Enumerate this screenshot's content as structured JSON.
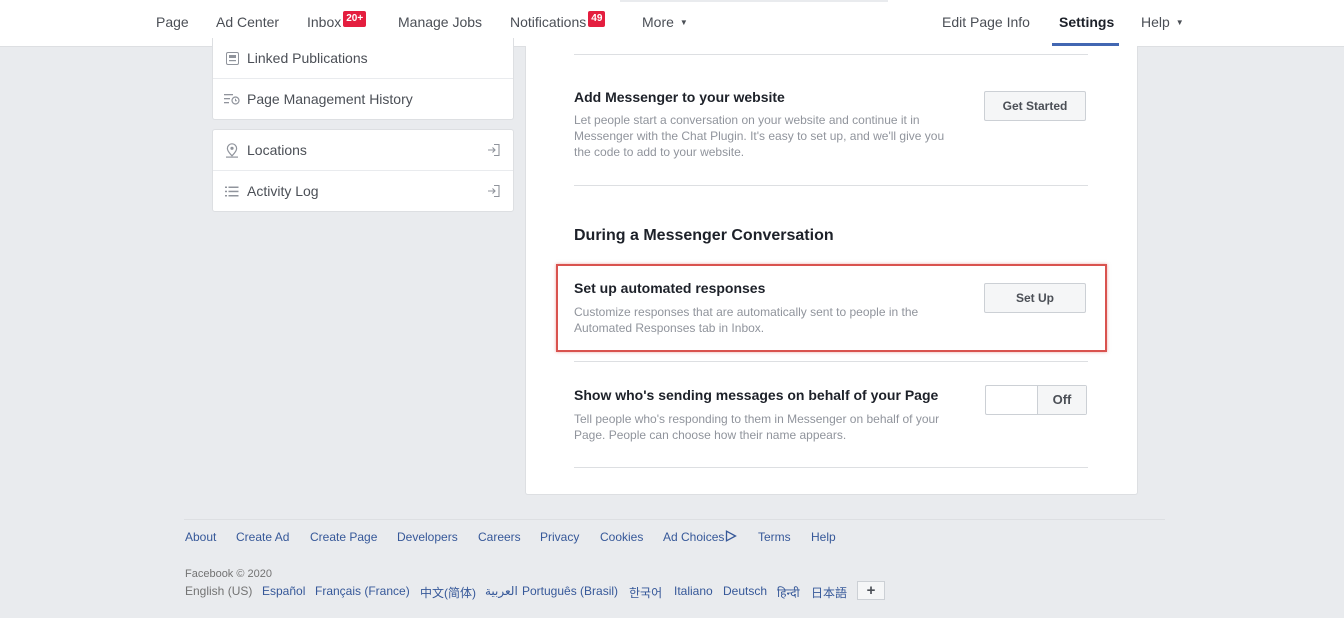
{
  "topnav": {
    "left_items": [
      {
        "label": "Page"
      },
      {
        "label": "Ad Center"
      },
      {
        "label": "Inbox",
        "badge": "20+"
      },
      {
        "label": "Manage Jobs"
      },
      {
        "label": "Notifications",
        "badge": "49"
      },
      {
        "label": "More"
      }
    ],
    "right_items": [
      {
        "label": "Edit Page Info"
      },
      {
        "label": "Settings",
        "active": true
      },
      {
        "label": "Help"
      }
    ]
  },
  "sidebar": {
    "group1": [
      {
        "label": "Linked Publications",
        "icon": "publication-icon"
      },
      {
        "label": "Page Management History",
        "icon": "history-icon"
      }
    ],
    "group2": [
      {
        "label": "Locations",
        "icon": "location-pin-icon"
      },
      {
        "label": "Activity Log",
        "icon": "list-icon"
      }
    ]
  },
  "main": {
    "add_messenger": {
      "title": "Add Messenger to your website",
      "description": "Let people start a conversation on your website and continue it in Messenger with the Chat Plugin. It's easy to set up, and we'll give you the code to add to your website.",
      "button": "Get Started"
    },
    "section_heading": "During a Messenger Conversation",
    "automated": {
      "title": "Set up automated responses",
      "description": "Customize responses that are automatically sent to people in the Automated Responses tab in Inbox.",
      "button": "Set Up"
    },
    "sender": {
      "title": "Show who's sending messages on behalf of your Page",
      "description": "Tell people who's responding to them in Messenger on behalf of your Page. People can choose how their name appears.",
      "toggle_label": "Off"
    }
  },
  "footer": {
    "links": [
      "About",
      "Create Ad",
      "Create Page",
      "Developers",
      "Careers",
      "Privacy",
      "Cookies",
      "Ad Choices",
      "Terms",
      "Help"
    ],
    "copyright": "Facebook © 2020",
    "current_language": "English (US)",
    "languages": [
      "Español",
      "Français (France)",
      "中文(简体)",
      "العربية",
      "Português (Brasil)",
      "한국어",
      "Italiano",
      "Deutsch",
      "हिन्दी",
      "日本語"
    ],
    "more_languages": "+"
  },
  "colors": {
    "accent": "#4267b2",
    "badge": "#e41e3f",
    "highlight": "#d9534f",
    "link": "#365899"
  }
}
